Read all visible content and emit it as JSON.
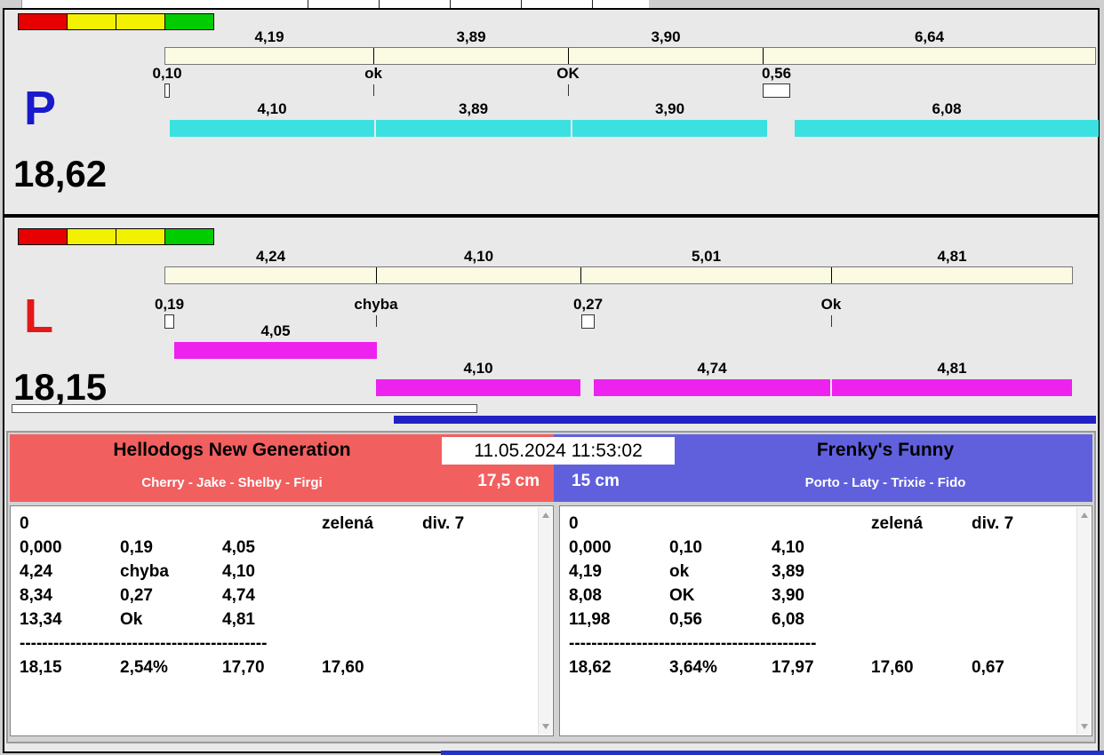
{
  "status_colors": [
    "#e60000",
    "#f2f200",
    "#f2f200",
    "#00cc00"
  ],
  "lanes": {
    "p": {
      "letter": "P",
      "letter_color": "#1a1acc",
      "total": "18,62",
      "run_color": "#3be0e0",
      "plan": [
        {
          "label": "4,19",
          "sec": 4.19
        },
        {
          "label": "3,89",
          "sec": 3.89
        },
        {
          "label": "3,90",
          "sec": 3.9
        },
        {
          "label": "6,64",
          "sec": 6.64
        }
      ],
      "markers": [
        {
          "label": "0,10",
          "at": 0,
          "type": "box",
          "sec": 0.1
        },
        {
          "label": "ok",
          "at": 4.19,
          "type": "tick"
        },
        {
          "label": "OK",
          "at": 8.08,
          "type": "tick"
        },
        {
          "label": "0,56",
          "at": 11.98,
          "type": "box",
          "sec": 0.56
        }
      ],
      "runs": [
        {
          "items": [
            {
              "gap": true,
              "sec": 0.1
            },
            {
              "label": "4,10",
              "sec": 4.1
            },
            {
              "label": "3,89",
              "sec": 3.89
            },
            {
              "label": "3,90",
              "sec": 3.9
            },
            {
              "gap": true,
              "sec": 0.56
            },
            {
              "label": "6,08",
              "sec": 6.08
            }
          ]
        }
      ]
    },
    "l": {
      "letter": "L",
      "letter_color": "#e31818",
      "total": "18,15",
      "run_color": "#ee22ee",
      "plan": [
        {
          "label": "4,24",
          "sec": 4.24
        },
        {
          "label": "4,10",
          "sec": 4.1
        },
        {
          "label": "5,01",
          "sec": 5.01
        },
        {
          "label": "4,81",
          "sec": 4.81
        }
      ],
      "markers": [
        {
          "label": "0,19",
          "at": 0,
          "type": "box",
          "sec": 0.19
        },
        {
          "label": "chyba",
          "at": 4.24,
          "type": "tick"
        },
        {
          "label": "0,27",
          "at": 8.34,
          "type": "box",
          "sec": 0.27
        },
        {
          "label": "Ok",
          "at": 13.35,
          "type": "tick"
        }
      ],
      "runs": [
        {
          "items": [
            {
              "gap": true,
              "sec": 0.19
            },
            {
              "label": "4,05",
              "sec": 4.05
            }
          ]
        },
        {
          "items": [
            {
              "gap": true,
              "sec": 4.24
            },
            {
              "label": "4,10",
              "sec": 4.1
            },
            {
              "gap": true,
              "sec": 0.27
            },
            {
              "label": "4,74",
              "sec": 4.74
            },
            {
              "label": "4,81",
              "sec": 4.81
            }
          ]
        }
      ]
    }
  },
  "scoreboard": {
    "datetime": "11.05.2024 11:53:02",
    "left_team": {
      "name": "Hellodogs New Generation",
      "dogs": "Cherry - Jake - Shelby - Firgi",
      "jump_height": "17,5 cm",
      "header_color": "#f25f5f",
      "rows": [
        [
          "0",
          "",
          "",
          "zelená",
          "div. 7"
        ],
        [
          "0,000",
          "0,19",
          "4,05",
          "",
          ""
        ],
        [
          "4,24",
          "chyba",
          "4,10",
          "",
          ""
        ],
        [
          "8,34",
          "0,27",
          "4,74",
          "",
          ""
        ],
        [
          "13,34",
          "Ok",
          "4,81",
          "",
          ""
        ],
        {
          "sep": "--------------------------------------------"
        },
        [
          "18,15",
          "2,54%",
          "17,70",
          "17,60",
          ""
        ]
      ]
    },
    "right_team": {
      "name": "Frenky's Funny",
      "dogs": "Porto - Laty - Trixie - Fido",
      "jump_height": "15 cm",
      "header_color": "#6060dd",
      "rows": [
        [
          "0",
          "",
          "",
          "zelená",
          "div. 7"
        ],
        [
          "0,000",
          "0,10",
          "4,10",
          "",
          ""
        ],
        [
          "4,19",
          "ok",
          "3,89",
          "",
          ""
        ],
        [
          "8,08",
          "OK",
          "3,90",
          "",
          ""
        ],
        [
          "11,98",
          "0,56",
          "6,08",
          "",
          ""
        ],
        {
          "sep": "--------------------------------------------"
        },
        [
          "18,62",
          "3,64%",
          "17,97",
          "17,60",
          "0,67"
        ]
      ]
    }
  }
}
